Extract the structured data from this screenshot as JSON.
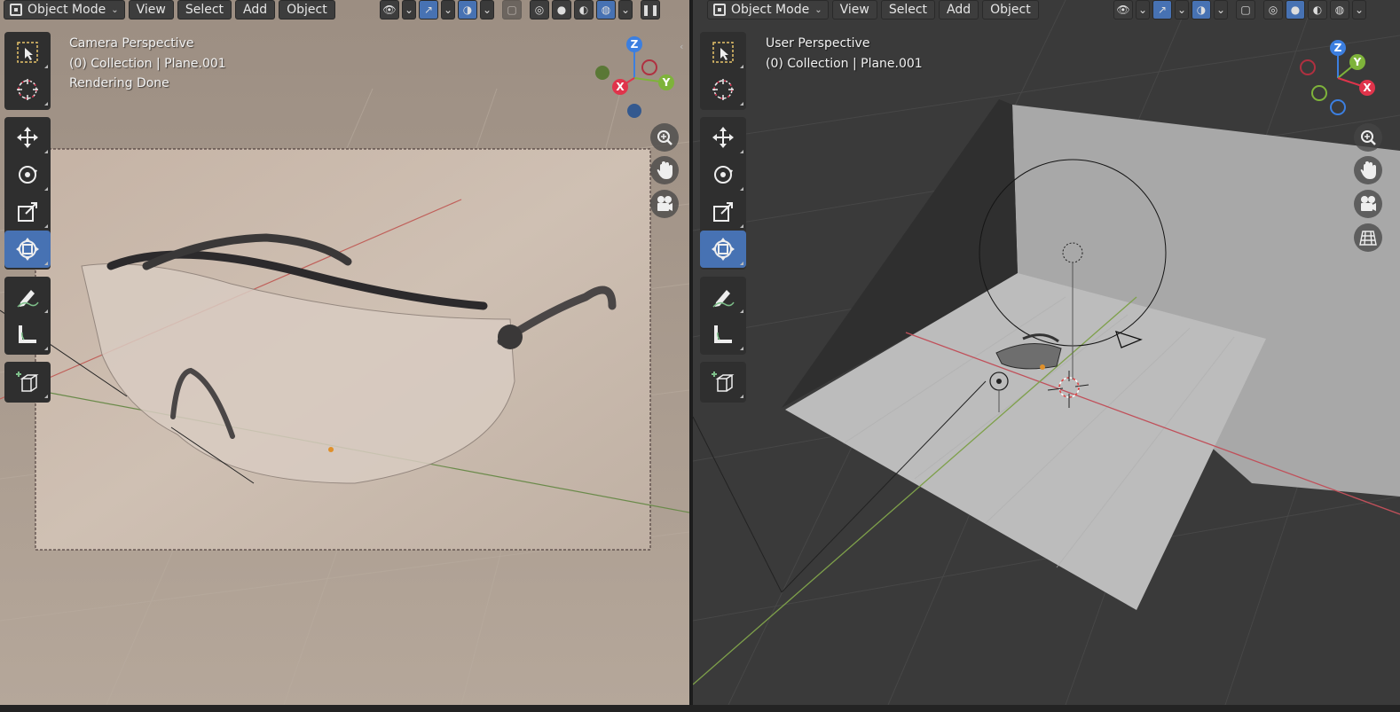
{
  "left_viewport": {
    "header": {
      "mode_label": "Object Mode",
      "menus": [
        "View",
        "Select",
        "Add",
        "Object"
      ]
    },
    "overlay": {
      "line1": "Camera Perspective",
      "line2": "(0) Collection | Plane.001",
      "line3": "Rendering Done"
    },
    "gizmo": {
      "x": "X",
      "y": "Y",
      "z": "Z"
    }
  },
  "right_viewport": {
    "header": {
      "mode_label": "Object Mode",
      "menus": [
        "View",
        "Select",
        "Add",
        "Object"
      ]
    },
    "overlay": {
      "line1": "User Perspective",
      "line2": "(0) Collection | Plane.001"
    },
    "gizmo": {
      "x": "X",
      "y": "Y",
      "z": "Z"
    }
  },
  "colors": {
    "active_tool": "#4772b3",
    "x_axis": "#e0344b",
    "y_axis": "#7eb33a",
    "z_axis": "#3c7fe0"
  },
  "tools": [
    "select-box-tool",
    "cursor-tool",
    "move-tool",
    "rotate-tool",
    "scale-tool",
    "transform-tool",
    "annotate-tool",
    "measure-tool",
    "add-cube-tool"
  ]
}
